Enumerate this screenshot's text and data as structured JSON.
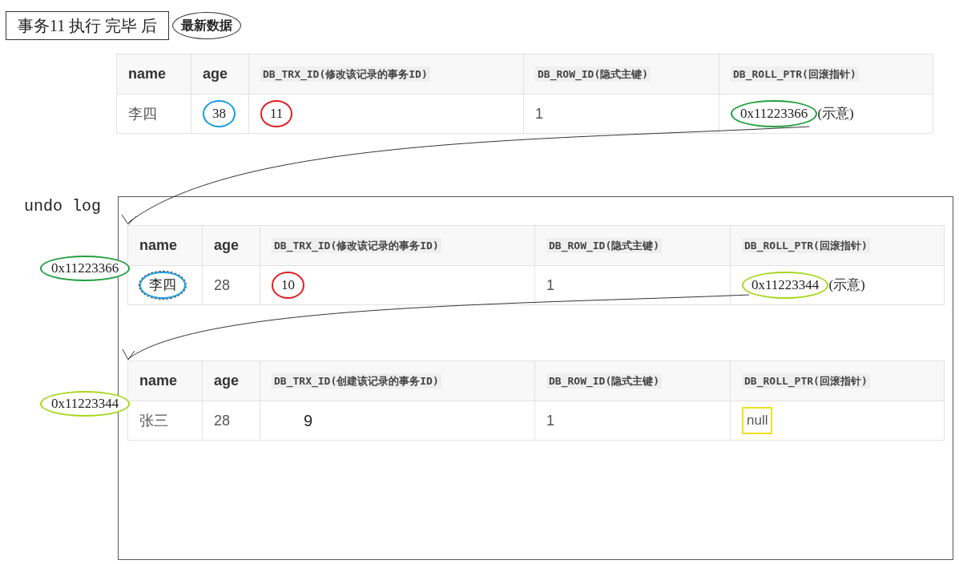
{
  "title": {
    "text": "事务11 执行 完毕 后",
    "tag": "最新数据"
  },
  "latest_table": {
    "columns": [
      "name",
      "age",
      "DB_TRX_ID(修改该记录的事务ID)",
      "DB_ROW_ID(隐式主键)",
      "DB_ROLL_PTR(回滚指针)"
    ],
    "row": [
      {
        "text": "李四"
      },
      {
        "text": "38",
        "color": "#1a9ce0"
      },
      {
        "text": "11",
        "color": "#e02020"
      },
      {
        "text": "1"
      },
      {
        "text": "0x11223366",
        "suffix": "(示意)",
        "color": "#20a040"
      }
    ]
  },
  "undo_log": {
    "label": "undo log",
    "entries": [
      {
        "address": "0x11223366",
        "color": "#20a040",
        "columns": [
          "name",
          "age",
          "DB_TRX_ID(修改该记录的事务ID)",
          "DB_ROW_ID(隐式主键)",
          "DB_ROLL_PTR(回滚指针)"
        ],
        "row": [
          {
            "text": "李四",
            "color": "#1a9ce0",
            "selected": true
          },
          {
            "text": "28"
          },
          {
            "text": "10",
            "color": "#e02020"
          },
          {
            "text": "1"
          },
          {
            "text": "0x11223344",
            "suffix": "(示意)",
            "color": "#a8d820"
          }
        ]
      },
      {
        "address": "0x11223344",
        "color": "#a8d820",
        "columns": [
          "name",
          "age",
          "DB_TRX_ID(创建该记录的事务ID)",
          "DB_ROW_ID(隐式主键)",
          "DB_ROLL_PTR(回滚指针)"
        ],
        "row": [
          {
            "text": "张三"
          },
          {
            "text": "28"
          },
          {
            "text": "9",
            "kind": "plain_dark"
          },
          {
            "text": "1"
          },
          {
            "text": "null",
            "kind": "boxed",
            "color": "#f0e020"
          }
        ]
      }
    ]
  }
}
